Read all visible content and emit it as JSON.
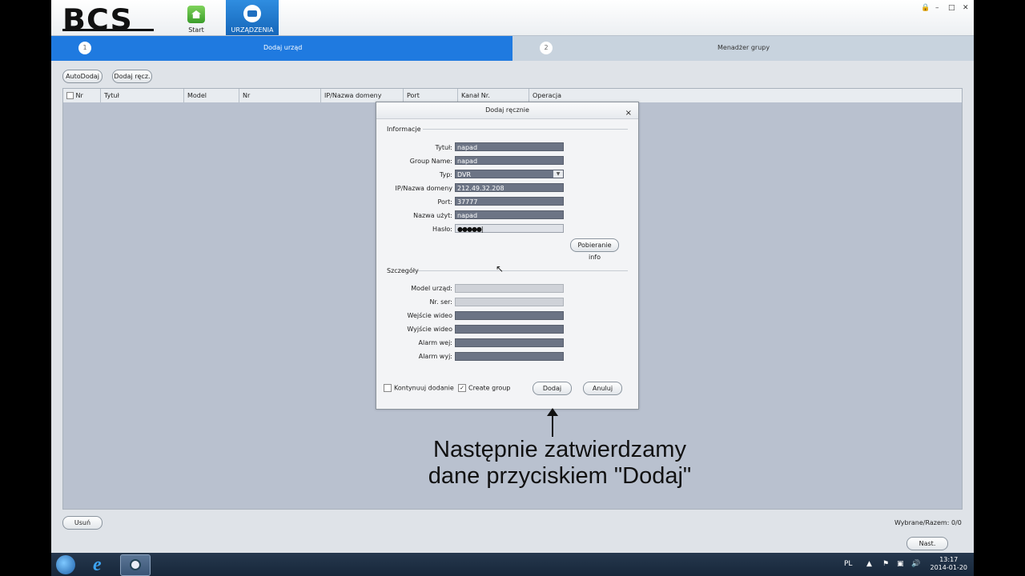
{
  "header": {
    "logo": "BCS",
    "logo_mark": "®",
    "nav": [
      {
        "label": "Start",
        "icon": "home-icon"
      },
      {
        "label": "URZĄDZENIA",
        "icon": "devices-icon"
      }
    ],
    "window_controls": [
      "🔒",
      "–",
      "□",
      "✕"
    ]
  },
  "steps": [
    {
      "num": "1",
      "label": "Dodaj urząd",
      "active": true
    },
    {
      "num": "2",
      "label": "Menadżer grupy",
      "active": false
    }
  ],
  "toolbar": {
    "auto_add": "AutoDodaj",
    "manual_add": "Dodaj ręcz."
  },
  "table": {
    "columns": [
      "Nr",
      "Tytuł",
      "Model",
      "Nr",
      "IP/Nazwa domeny",
      "Port",
      "Kanał Nr.",
      "Operacja"
    ]
  },
  "footer": {
    "delete": "Usuń",
    "selected_label": "Wybrane/Razem:",
    "selected_value": "0/0",
    "next": "Nast."
  },
  "dialog": {
    "title": "Dodaj ręcznie",
    "close": "×",
    "section_info": "Informacje",
    "fields": {
      "title_label": "Tytuł:",
      "title_value": "napad",
      "group_label": "Group Name:",
      "group_value": "napad",
      "type_label": "Typ:",
      "type_value": "DVR",
      "ip_label": "IP/Nazwa domeny",
      "ip_value": "212.49.32.208",
      "port_label": "Port:",
      "port_value": "37777",
      "user_label": "Nazwa użyt:",
      "user_value": "napad",
      "pass_label": "Hasło:",
      "pass_value": "●●●●●|"
    },
    "fetch_info": "Pobieranie info",
    "section_details": "Szczegóły",
    "details": {
      "model_label": "Model urząd:",
      "serial_label": "Nr. ser:",
      "video_in_label": "Wejście wideo",
      "video_out_label": "Wyjście wideo",
      "alarm_in_label": "Alarm wej:",
      "alarm_out_label": "Alarm wyj:"
    },
    "continue_label": "Kontynuuj dodanie",
    "continue_checked": false,
    "create_group_label": "Create group",
    "create_group_checked": true,
    "add": "Dodaj",
    "cancel": "Anuluj"
  },
  "annotation": {
    "line1": "Następnie zatwierdzamy",
    "line2": "dane przyciskiem \"Dodaj\""
  },
  "taskbar": {
    "lang": "PL",
    "time": "13:17",
    "date": "2014-01-20"
  },
  "colors": {
    "accent": "#1f7ae0",
    "field": "#6c7485"
  }
}
